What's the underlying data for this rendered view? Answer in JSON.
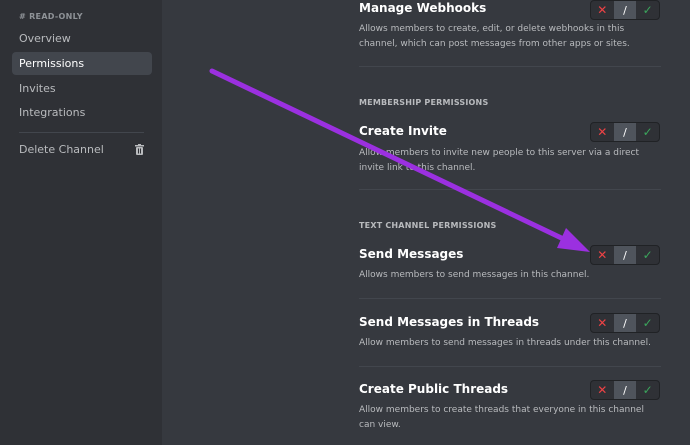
{
  "sidebar": {
    "header": "# READ-ONLY",
    "items": [
      {
        "label": "Overview"
      },
      {
        "label": "Permissions"
      },
      {
        "label": "Invites"
      },
      {
        "label": "Integrations"
      }
    ],
    "delete_label": "Delete Channel"
  },
  "permissions": {
    "manage_webhooks": {
      "title": "Manage Webhooks",
      "desc": "Allows members to create, edit, or delete webhooks in this channel, which can post messages from other apps or sites."
    },
    "membership_label": "MEMBERSHIP PERMISSIONS",
    "create_invite": {
      "title": "Create Invite",
      "desc": "Allow members to invite new people to this server via a direct invite link to this channel."
    },
    "text_label": "TEXT CHANNEL PERMISSIONS",
    "send_messages": {
      "title": "Send Messages",
      "desc": "Allows members to send messages in this channel."
    },
    "send_in_threads": {
      "title": "Send Messages in Threads",
      "desc": "Allow members to send messages in threads under this channel."
    },
    "create_public_threads": {
      "title": "Create Public Threads",
      "desc": "Allow members to create threads that everyone in this channel can view."
    }
  },
  "toggle": {
    "deny": "✕",
    "neutral": "/",
    "allow": "✓"
  },
  "colors": {
    "deny": "#ed4245",
    "allow": "#3ba55c",
    "arrow": "#9b30e0"
  }
}
